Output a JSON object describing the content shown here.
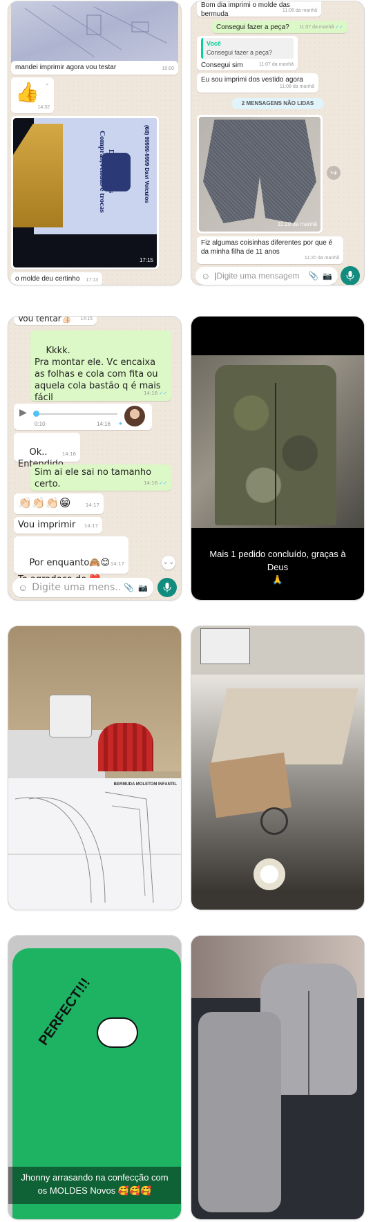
{
  "card1": {
    "caption1": "mandei imprimir agora vou testar",
    "time1": "10:00",
    "reaction_emoji": "👍",
    "time2": "14:32",
    "tshirt_text": "Davi Veículos Compras,Vendas e trocas",
    "tshirt_side_text": "(68) 99999-9999 Davi Veículos",
    "time3": "17:15",
    "caption2": "o molde deu certinho",
    "time4": "17:13"
  },
  "card2": {
    "msg1": "Bom dia imprimi o molde das bermuda",
    "msg1_time": "11:06 da manhã",
    "msg2": "Consegui fazer a peça?",
    "msg2_time": "11:07 da manhã",
    "quote_name": "Você",
    "quote_text": "Consegui fazer a peça?",
    "msg3": "Consegui sim",
    "msg3_time": "11:07 da manhã",
    "msg4": "Eu sou imprimi dos vestido agora",
    "msg4_time": "11:08 da manhã",
    "unread": "2 MENSAGENS NÃO LIDAS",
    "photo_time": "11:20 da manhã",
    "msg5": "Fiz algumas coisinhas diferentes por que é da minha filha de 11 anos",
    "msg5_time": "11:20 da manhã",
    "input_placeholder": "Digite uma mensagem"
  },
  "card3": {
    "top_msg": "Vou tentar👍🏻",
    "top_time": "14:15",
    "msg1": "Kkkk.\nPra montar ele. Vc encaixa as folhas e cola com fita ou aquela cola bastão q é mais fácil",
    "msg1_time": "14:16",
    "audio_elapsed": "0:10",
    "audio_time": "14:16",
    "audio_progress": 0.02,
    "msg2": "Ok..\nEntendido",
    "msg2_time": "14:16",
    "msg3": "Sim ai ele sai no tamanho certo.",
    "msg3_time": "14:16",
    "msg4": "👏🏻👏🏻👏🏻😁",
    "msg4_time": "14:17",
    "msg5": "Vou imprimir",
    "msg5_time": "14:17",
    "msg6": "Por enquanto🙈😊\nTe agradeço de ❤️",
    "msg6_time": "14:17",
    "input_placeholder": "Digite uma mens..."
  },
  "card4": {
    "caption": "Mais 1 pedido concluído, graças à Deus",
    "caption_emoji": "🙏"
  },
  "card5": {
    "pattern_header": "BERMUDA MOLETOM INFANTIL"
  },
  "card6": {},
  "card7": {
    "shirt_text": "PERFECT!!!",
    "caption": "Jhonny arrasando na confecção com os MOLDES Novos 🥰🥰🥰"
  },
  "card8": {},
  "colors": {
    "wa_green": "#128c7e",
    "bubble_out": "#dcf8c6",
    "wa_bg": "#efe6dc"
  }
}
